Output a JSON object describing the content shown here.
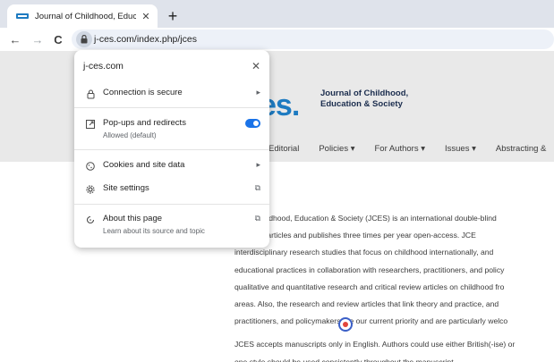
{
  "tab": {
    "title": "Journal of Childhood, Educatio",
    "close_glyph": "✕",
    "favicon": "jces-favicon"
  },
  "newtab": {
    "glyph": "+"
  },
  "toolbar": {
    "back": "←",
    "forward": "→",
    "reload": "C",
    "url": "j-ces.com/index.php/jces"
  },
  "site": {
    "logo_big": "es.",
    "logo_line1": "Journal of Childhood,",
    "logo_line2": "Education & Society",
    "nav": [
      "Editorial",
      "Policies ▾",
      "For Authors ▾",
      "Issues ▾",
      "Abstracting &"
    ]
  },
  "article": {
    "lines": [
      "nal of Childhood, Education & Society (JCES) is an international double-blind",
      "al review articles and publishes three times per year open-access. JCE",
      "interdisciplinary research studies that focus on childhood internationally, and",
      "educational practices in collaboration with researchers, practitioners, and policy",
      "qualitative and quantitative research and critical review articles on childhood fro",
      "areas. Also, the research and review articles that link theory and practice, and",
      "practitioners, and policymakers are our current priority and are particularly welco"
    ],
    "lines2": [
      "JCES accepts manuscripts only in English. Authors could use either British(-ise) or",
      "one style should be used consistently throughout the manuscript."
    ]
  },
  "popup": {
    "header": "j-ces.com",
    "close": "✕",
    "connection": "Connection is secure",
    "popups_label": "Pop-ups and redirects",
    "popups_sub": "Allowed (default)",
    "popups_toggle": true,
    "cookies": "Cookies and site data",
    "settings": "Site settings",
    "about": "About this page",
    "about_sub": "Learn about its source and topic",
    "arrow": "▸",
    "external": "⧉"
  },
  "colors": {
    "accent": "#1a73e8",
    "logo": "#1e7bc1"
  }
}
